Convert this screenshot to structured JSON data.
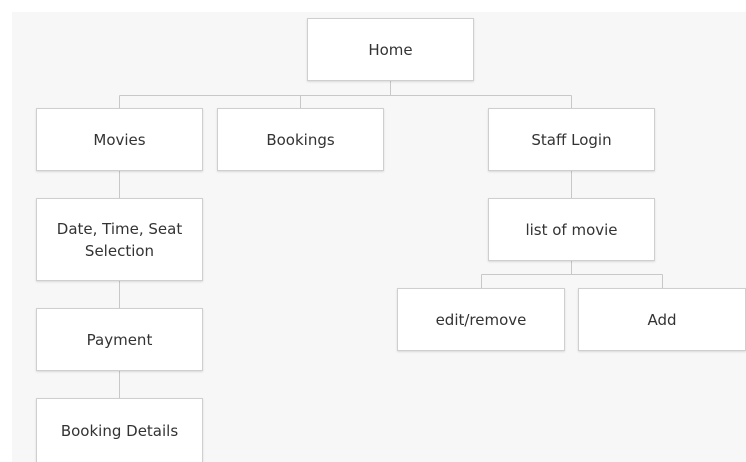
{
  "nodes": {
    "home": "Home",
    "movies": "Movies",
    "bookings": "Bookings",
    "staff_login": "Staff Login",
    "date_time_seat": "Date, Time, Seat Selection",
    "list_of_movie": "list of movie",
    "payment": "Payment",
    "edit_remove": "edit/remove",
    "add": "Add",
    "booking_details": "Booking Details"
  },
  "edges": [
    [
      "home",
      "movies"
    ],
    [
      "home",
      "bookings"
    ],
    [
      "home",
      "staff_login"
    ],
    [
      "movies",
      "date_time_seat"
    ],
    [
      "date_time_seat",
      "payment"
    ],
    [
      "payment",
      "booking_details"
    ],
    [
      "staff_login",
      "list_of_movie"
    ],
    [
      "list_of_movie",
      "edit_remove"
    ],
    [
      "list_of_movie",
      "add"
    ]
  ],
  "colors": {
    "background_panel": "#f7f7f7",
    "node_fill": "#ffffff",
    "node_border": "#cfcfcf",
    "connector": "#c8c8c8",
    "text": "#333333"
  }
}
